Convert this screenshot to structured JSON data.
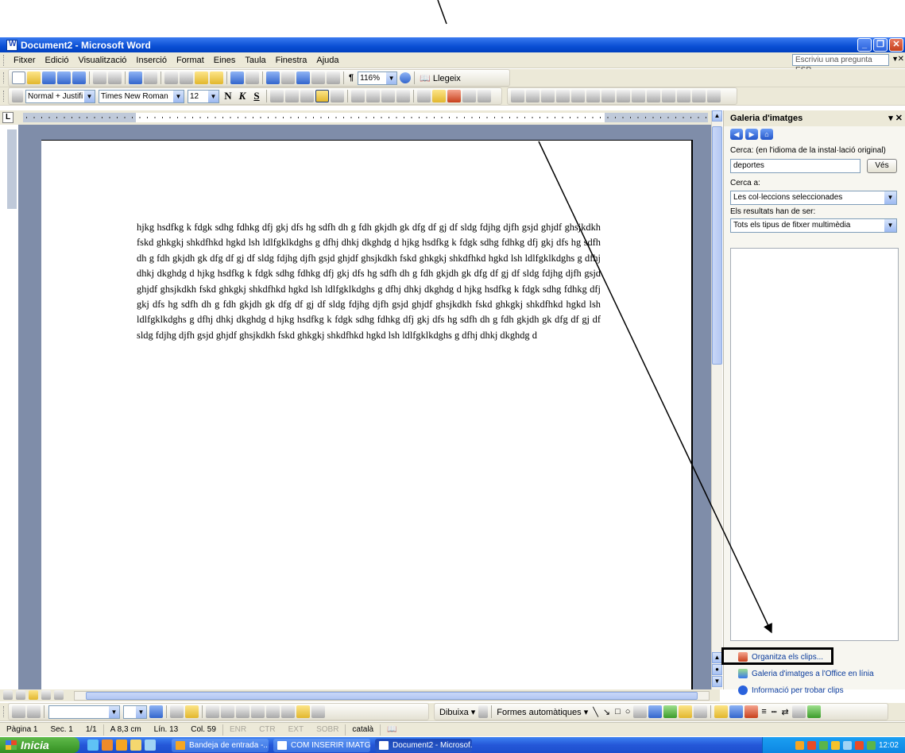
{
  "window": {
    "title": "Document2 - Microsoft Word"
  },
  "menu": {
    "items": [
      "Fitxer",
      "Edició",
      "Visualització",
      "Inserció",
      "Format",
      "Eines",
      "Taula",
      "Finestra",
      "Ajuda"
    ],
    "ask_placeholder": "Escriviu una pregunta ESP"
  },
  "standard_toolbar": {
    "zoom": "116%",
    "read_label": "Llegeix"
  },
  "format_toolbar": {
    "style": "Normal + Justifi",
    "font": "Times New Roman",
    "size": "12",
    "bold": "N",
    "italic": "K",
    "underline": "S"
  },
  "document": {
    "body": "hjkg hsdfkg k fdgk sdhg fdhkg dfj gkj dfs hg sdfh dh g fdh gkjdh gk dfg df gj df sldg fdjhg djfh gsjd ghjdf ghsjkdkh fskd ghkgkj shkdfhkd hgkd lsh ldlfgklkdghs g dfhj dhkj dkghdg d hjkg hsdfkg k fdgk sdhg fdhkg dfj gkj dfs hg sdfh dh g fdh gkjdh gk dfg df gj df sldg fdjhg djfh gsjd ghjdf ghsjkdkh fskd ghkgkj shkdfhkd hgkd lsh ldlfgklkdghs g dfhj dhkj dkghdg d hjkg hsdfkg k fdgk sdhg fdhkg dfj gkj dfs hg sdfh dh g fdh gkjdh gk dfg df gj df sldg fdjhg djfh gsjd ghjdf ghsjkdkh fskd ghkgkj shkdfhkd hgkd lsh ldlfgklkdghs g dfhj dhkj dkghdg d hjkg hsdfkg k fdgk sdhg fdhkg dfj gkj dfs hg sdfh dh g fdh gkjdh gk dfg df gj df sldg fdjhg djfh gsjd ghjdf ghsjkdkh fskd ghkgkj shkdfhkd hgkd lsh ldlfgklkdghs g dfhj dhkj dkghdg d hjkg hsdfkg k fdgk sdhg fdhkg dfj gkj dfs hg sdfh dh g fdh gkjdh gk dfg df gj df sldg fdjhg djfh gsjd ghjdf ghsjkdkh fskd ghkgkj shkdfhkd hgkd lsh ldlfgklkdghs g dfhj dhkj dkghdg d"
  },
  "task_pane": {
    "title": "Galeria d'imatges",
    "search_label": "Cerca: (en l'idioma de la instal·lació original)",
    "search_value": "deportes",
    "go_button": "Vés",
    "search_in_label": "Cerca a:",
    "search_in_value": "Les col·leccions seleccionades",
    "results_label": "Els resultats han de ser:",
    "results_value": "Tots els tipus de fitxer multimèdia",
    "links": [
      {
        "label": "Organitza els clips...",
        "icon": "organize-clips-icon"
      },
      {
        "label": "Galeria d'imatges a l'Office en línia",
        "icon": "clipart-online-icon"
      },
      {
        "label": "Informació per trobar clips",
        "icon": "help-icon"
      }
    ]
  },
  "drawing_toolbar": {
    "draw_label": "Dibuixa",
    "autoshapes_label": "Formes automàtiques"
  },
  "status_bar": {
    "page": "Pàgina 1",
    "section": "Sec. 1",
    "pages": "1/1",
    "at": "A 8,3 cm",
    "line": "Lín. 13",
    "col": "Col. 59",
    "rec": "ENR",
    "trk": "CTR",
    "ext": "EXT",
    "ovr": "SOBR",
    "language": "català"
  },
  "taskbar": {
    "start_label": "Inicia",
    "buttons": [
      "Bandeja de entrada -...",
      "COM INSERIR IMATG...",
      "Document2 - Microsof..."
    ],
    "clock": "12:02"
  },
  "colors": {
    "titlebar": "#0a4fd4",
    "chrome": "#ece9d8",
    "doc_background": "#7f8da9",
    "taskbar": "#2457d8"
  }
}
